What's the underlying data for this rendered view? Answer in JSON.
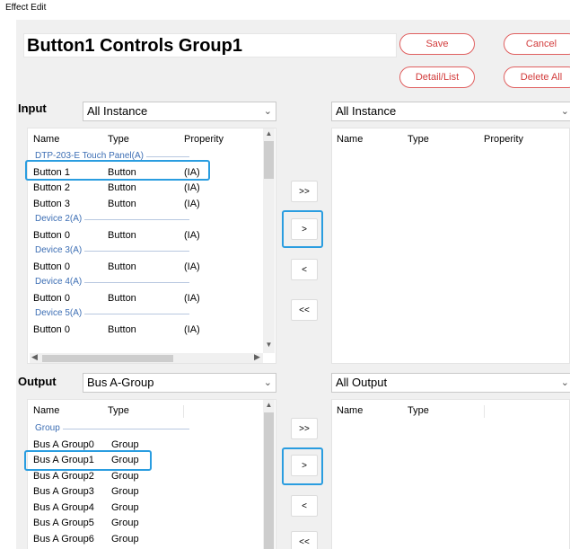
{
  "window_title": "Effect Edit",
  "effect_name": "Button1 Controls Group1",
  "buttons": {
    "save": "Save",
    "cancel": "Cancel",
    "detail_list": "Detail/List",
    "delete_all": "Delete All"
  },
  "input": {
    "label": "Input",
    "filter": "All Instance",
    "right_filter": "All Instance",
    "columns": [
      "Name",
      "Type",
      "Properity"
    ],
    "groups": [
      {
        "name": "DTP-203-E Touch Panel(A)",
        "rows": [
          {
            "name": "Button 1",
            "type": "Button",
            "prop": "(IA)"
          },
          {
            "name": "Button 2",
            "type": "Button",
            "prop": "(IA)"
          },
          {
            "name": "Button 3",
            "type": "Button",
            "prop": "(IA)"
          }
        ]
      },
      {
        "name": "Device 2(A)",
        "rows": [
          {
            "name": "Button 0",
            "type": "Button",
            "prop": "(IA)"
          }
        ]
      },
      {
        "name": "Device 3(A)",
        "rows": [
          {
            "name": "Button 0",
            "type": "Button",
            "prop": "(IA)"
          }
        ]
      },
      {
        "name": "Device 4(A)",
        "rows": [
          {
            "name": "Button 0",
            "type": "Button",
            "prop": "(IA)"
          }
        ]
      },
      {
        "name": "Device 5(A)",
        "rows": [
          {
            "name": "Button 0",
            "type": "Button",
            "prop": "(IA)"
          }
        ]
      }
    ]
  },
  "output": {
    "label": "Output",
    "filter": "Bus A-Group",
    "right_filter": "All Output",
    "columns": [
      "Name",
      "Type"
    ],
    "groups": [
      {
        "name": "Group",
        "rows": [
          {
            "name": "Bus A Group0",
            "type": "Group"
          },
          {
            "name": "Bus A Group1",
            "type": "Group"
          },
          {
            "name": "Bus A Group2",
            "type": "Group"
          },
          {
            "name": "Bus A Group3",
            "type": "Group"
          },
          {
            "name": "Bus A Group4",
            "type": "Group"
          },
          {
            "name": "Bus A Group5",
            "type": "Group"
          },
          {
            "name": "Bus A Group6",
            "type": "Group"
          }
        ]
      }
    ]
  },
  "move_buttons": [
    ">>",
    ">",
    "<",
    "<<"
  ],
  "icons": {
    "dropdown": "chevron-down-icon",
    "scroll_up": "scroll-up-arrow-icon",
    "scroll_down": "scroll-down-arrow-icon",
    "scroll_left": "scroll-left-arrow-icon",
    "scroll_right": "scroll-right-arrow-icon"
  },
  "colors": {
    "accent_red": "#d23c3c",
    "highlight_blue": "#2a9de0",
    "group_blue": "#3c6eb4",
    "panel_bg": "#f0f0f0"
  }
}
